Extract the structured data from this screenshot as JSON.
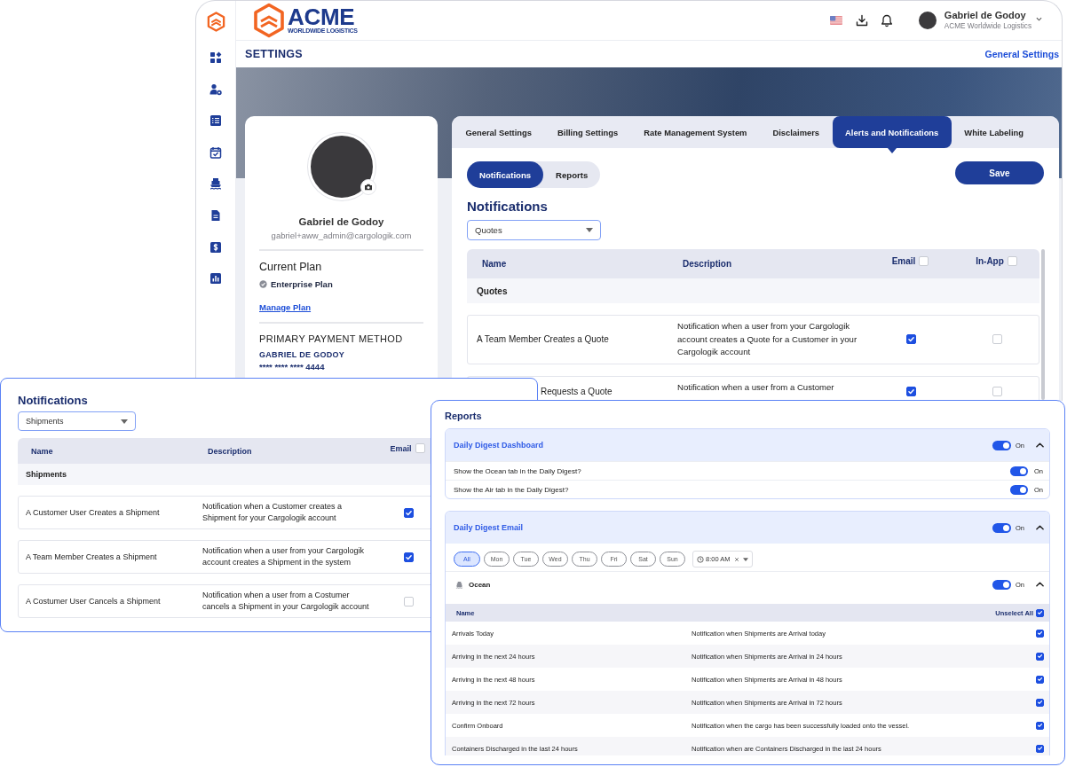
{
  "main_window": {
    "header": {
      "logo": {
        "wordmark": "ACME",
        "tagline": "WORLDWIDE LOGISTICS"
      },
      "user": {
        "name": "Gabriel de Godoy",
        "company": "ACME Worldwide Logistics"
      }
    },
    "page": {
      "title": "SETTINGS",
      "link": "General Settings"
    },
    "profile": {
      "name": "Gabriel de Godoy",
      "email": "gabriel+aww_admin@cargologik.com",
      "plan_heading": "Current Plan",
      "plan": "Enterprise Plan",
      "plan_link": "Manage Plan",
      "payment_heading": "PRIMARY PAYMENT METHOD",
      "card_holder": "GABRIEL DE GODOY",
      "card_number": "**** **** **** 4444"
    },
    "tabs": [
      {
        "label": "General Settings",
        "selected": false
      },
      {
        "label": "Billing Settings",
        "selected": false
      },
      {
        "label": "Rate Management System",
        "selected": false
      },
      {
        "label": "Disclaimers",
        "selected": false
      },
      {
        "label": "Alerts and Notifications",
        "selected": true
      },
      {
        "label": "White Labeling",
        "selected": false
      }
    ],
    "segments": [
      {
        "label": "Notifications",
        "selected": true
      },
      {
        "label": "Reports",
        "selected": false
      }
    ],
    "save_button": "Save",
    "notifications": {
      "title": "Notifications",
      "select": {
        "value": "Quotes"
      },
      "columns": [
        {
          "label": "Name"
        },
        {
          "label": "Description"
        },
        {
          "label": "Email",
          "checked": false
        },
        {
          "label": "In-App",
          "checked": false
        }
      ],
      "group": "Quotes",
      "rows": [
        {
          "name": "A Team Member Creates a Quote",
          "description": "Notification when a user from your Cargologik account creates a Quote for a Customer in your Cargologik account",
          "email": true,
          "in_app": false
        },
        {
          "name": "Requests a Quote",
          "description": "Notification when a user from a Customer",
          "email": true,
          "in_app": false
        }
      ]
    }
  },
  "shipments_panel": {
    "title": "Notifications",
    "select": {
      "value": "Shipments"
    },
    "columns": [
      {
        "label": "Name"
      },
      {
        "label": "Description"
      },
      {
        "label": "Email",
        "checked": false
      }
    ],
    "group": "Shipments",
    "rows": [
      {
        "name": "A Customer User Creates a Shipment",
        "description": "Notification when a Customer creates a Shipment for your Cargologik account",
        "email": true
      },
      {
        "name": "A Team Member Creates a Shipment",
        "description": "Notification when a user from your Cargologik account creates a Shipment in the system",
        "email": true
      },
      {
        "name": "A Costumer User Cancels a Shipment",
        "description": "Notification when a user from a Costumer cancels a Shipment in your Cargologik account",
        "email": false
      }
    ]
  },
  "reports_panel": {
    "title": "Reports",
    "sections": [
      {
        "kind": "options",
        "title": "Daily Digest Dashboard",
        "on": true,
        "toggle_label": "On",
        "expanded": true,
        "options": [
          {
            "label": "Show the Ocean tab in the Daily Digest?",
            "on": true,
            "toggle_label": "On"
          },
          {
            "label": "Show the Air tab in the Daily Digest?",
            "on": true,
            "toggle_label": "On"
          }
        ]
      },
      {
        "kind": "schedule",
        "title": "Daily Digest Email",
        "on": true,
        "toggle_label": "On",
        "expanded": true,
        "days": [
          {
            "label": "All",
            "selected": true
          },
          {
            "label": "Mon",
            "selected": false
          },
          {
            "label": "Tue",
            "selected": false
          },
          {
            "label": "Wed",
            "selected": false
          },
          {
            "label": "Thu",
            "selected": false
          },
          {
            "label": "Fri",
            "selected": false
          },
          {
            "label": "Sat",
            "selected": false
          },
          {
            "label": "Sun",
            "selected": false
          }
        ],
        "time": {
          "value": "8:00 AM"
        },
        "modes": [
          {
            "label": "Ocean",
            "on": true,
            "toggle_label": "On",
            "expanded": true,
            "columns": [
              {
                "label": "Name"
              },
              {
                "label": "Unselect All",
                "checked": true
              }
            ],
            "rows": [
              {
                "name": "Arrivals Today",
                "description": "Notification when Shipments are Arrival today",
                "checked": true
              },
              {
                "name": "Arriving in the next 24 hours",
                "description": "Notification when Shipments are Arrival in 24 hours",
                "checked": true
              },
              {
                "name": "Arriving in the next 48 hours",
                "description": "Notification when Shipments are Arrival in 48 hours",
                "checked": true
              },
              {
                "name": "Arriving in the next 72 hours",
                "description": "Notification when Shipments are Arrival in 72 hours",
                "checked": true
              },
              {
                "name": "Confirm Onboard",
                "description": "Notification when the cargo has been successfully loaded onto the vessel.",
                "checked": true
              },
              {
                "name": "Containers Discharged in the last 24 hours",
                "description": "Notification when are Containers Discharged in the last 24 hours",
                "checked": true
              }
            ]
          }
        ]
      }
    ]
  }
}
